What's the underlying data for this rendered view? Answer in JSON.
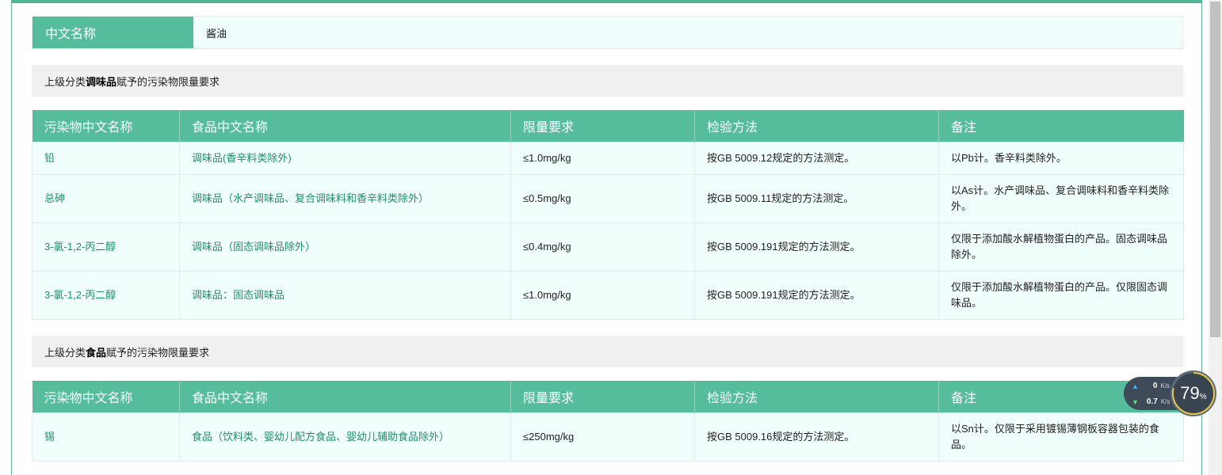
{
  "product": {
    "name_label": "中文名称",
    "name_value": "酱油"
  },
  "sections": [
    {
      "title_prefix": "上级分类",
      "title_category": "调味品",
      "title_suffix": "赋予的污染物限量要求",
      "headers": [
        "污染物中文名称",
        "食品中文名称",
        "限量要求",
        "检验方法",
        "备注"
      ],
      "rows": [
        {
          "pollutant": "铅",
          "food": "调味品(香辛料类除外)",
          "limit": "≤1.0mg/kg",
          "method": "按GB 5009.12规定的方法测定。",
          "note": "以Pb计。香辛料类除外。"
        },
        {
          "pollutant": "总砷",
          "food": "调味品（水产调味品、复合调味料和香辛料类除外）",
          "limit": "≤0.5mg/kg",
          "method": "按GB 5009.11规定的方法测定。",
          "note": "以As计。水产调味品、复合调味料和香辛料类除外。"
        },
        {
          "pollutant": "3-氯-1,2-丙二醇",
          "food": "调味品（固态调味品除外）",
          "limit": "≤0.4mg/kg",
          "method": "按GB 5009.191规定的方法测定。",
          "note": "仅限于添加酸水解植物蛋白的产品。固态调味品除外。"
        },
        {
          "pollutant": "3-氯-1,2-丙二醇",
          "food": "调味品：固态调味品",
          "limit": "≤1.0mg/kg",
          "method": "按GB 5009.191规定的方法测定。",
          "note": "仅限于添加酸水解植物蛋白的产品。仅限固态调味品。"
        }
      ]
    },
    {
      "title_prefix": "上级分类",
      "title_category": "食品",
      "title_suffix": "赋予的污染物限量要求",
      "headers": [
        "污染物中文名称",
        "食品中文名称",
        "限量要求",
        "检验方法",
        "备注"
      ],
      "rows": [
        {
          "pollutant": "锡",
          "food": "食品（饮料类、婴幼儿配方食品、婴幼儿辅助食品除外）",
          "limit": "≤250mg/kg",
          "method": "按GB 5009.16规定的方法测定。",
          "note": "以Sn计。仅限于采用镀锡薄钢板容器包装的食品。"
        }
      ]
    }
  ],
  "net_widget": {
    "upload_value": "0",
    "upload_unit": "K/s",
    "download_value": "0.7",
    "download_unit": "K/s",
    "gauge_value": "79",
    "gauge_unit": "%",
    "gauge_percent": 79,
    "up_color": "#4cb2ff",
    "down_color": "#5fe07a"
  },
  "colors": {
    "header_green": "#55bd9c",
    "row_bg": "#f0fffb",
    "link_green": "#1f8f6c",
    "section_gray": "#f0f0f0"
  }
}
